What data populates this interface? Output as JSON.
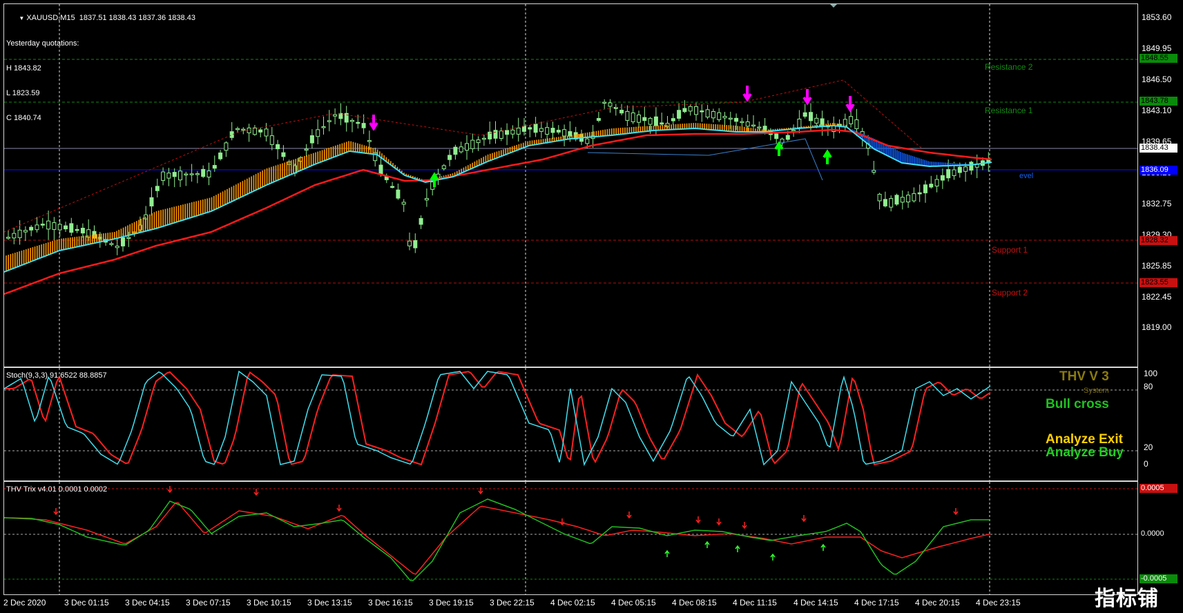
{
  "header": {
    "symbol_line": "XAUUSD,M15  1837.51 1838.43 1837.36 1838.43",
    "yesterday_title": "Yesterday quotations:",
    "yesterday_h": "H 1843.82",
    "yesterday_l": "L 1823.59",
    "yesterday_c": "C 1840.74"
  },
  "price_axis": {
    "ticks": [
      "1853.60",
      "1849.95",
      "1846.50",
      "1843.10",
      "1839.65",
      "1836.20",
      "1832.75",
      "1829.30",
      "1825.85",
      "1822.45",
      "1819.00"
    ],
    "tags": [
      {
        "text": "1848.55",
        "bg": "#0a8a0a",
        "fg": "#000000"
      },
      {
        "text": "1843.78",
        "bg": "#0a8a0a",
        "fg": "#000000"
      },
      {
        "text": "1838.43",
        "bg": "#ffffff",
        "fg": "#000000"
      },
      {
        "text": "1836.09",
        "bg": "#0000ff",
        "fg": "#ffffff"
      },
      {
        "text": "1828.32",
        "bg": "#c81010",
        "fg": "#000000"
      },
      {
        "text": "1823.55",
        "bg": "#c81010",
        "fg": "#000000"
      }
    ]
  },
  "levels": {
    "resistance2": "Resistance 2",
    "resistance1": "Resistance 1",
    "support1": "Support 1",
    "support2": "Support 2",
    "level_label": "evel"
  },
  "stoch": {
    "title": "Stoch(9,3,3) 91.6522 88.8857",
    "axis": [
      "100",
      "80",
      "20",
      "0"
    ],
    "thv_title": "THV V 3",
    "system_label": "System",
    "bull_cross": "Bull cross",
    "analyze_exit": "Analyze Exit",
    "analyze_buy": "Analyze Buy"
  },
  "trix": {
    "title": "THV Trix v4.01 0.0001 0.0002",
    "tags": [
      {
        "text": "0.0005",
        "bg": "#c81010",
        "fg": "#ffffff"
      },
      {
        "text": "0.0000",
        "bg": "#000000",
        "fg": "#ffffff"
      },
      {
        "text": "-0.0005",
        "bg": "#0a8a0a",
        "fg": "#ffffff"
      }
    ]
  },
  "time_axis": [
    "2 Dec 2020",
    "3 Dec 01:15",
    "3 Dec 04:15",
    "3 Dec 07:15",
    "3 Dec 10:15",
    "3 Dec 13:15",
    "3 Dec 16:15",
    "3 Dec 19:15",
    "3 Dec 22:15",
    "4 Dec 02:15",
    "4 Dec 05:15",
    "4 Dec 08:15",
    "4 Dec 11:15",
    "4 Dec 14:15",
    "4 Dec 17:15",
    "4 Dec 20:15",
    "4 Dec 23:15"
  ],
  "watermark": "指标铺",
  "colors": {
    "bull_candle": "#90ee90",
    "orange_band": "#ff9900",
    "red_ma": "#ff1a1a",
    "cyan_ma": "#40e0f0",
    "blue_band": "#1060ff",
    "magenta_arrow": "#ff00ff",
    "green_arrow": "#00ff00"
  }
}
